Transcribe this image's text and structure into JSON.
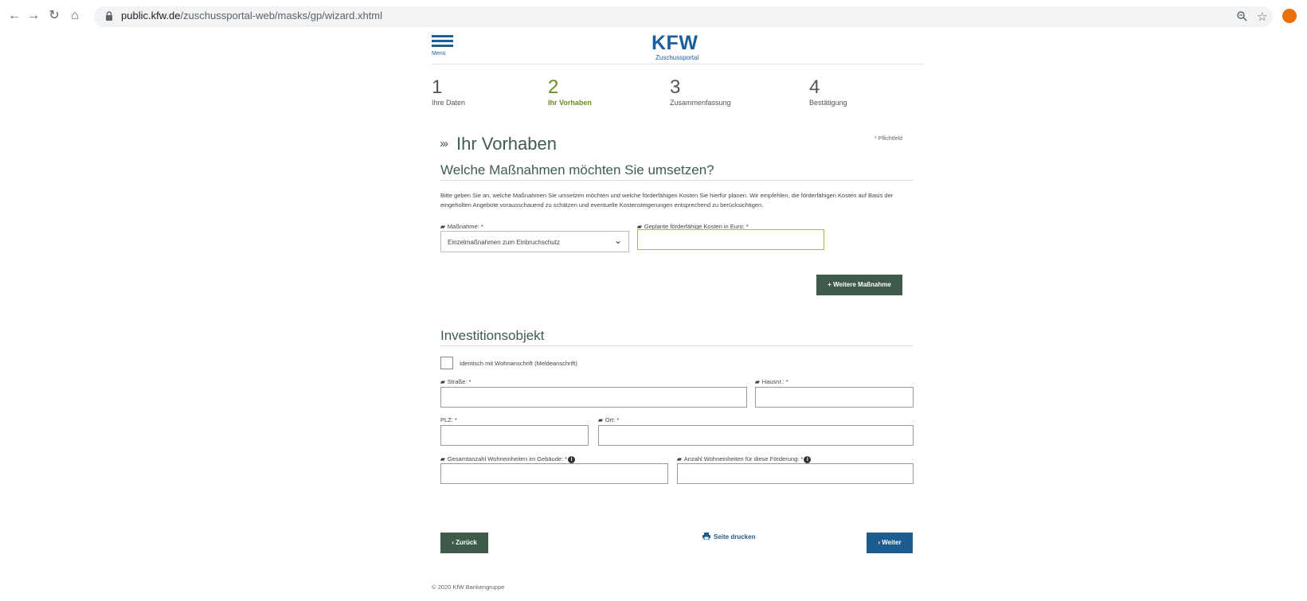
{
  "browser": {
    "url_host": "public.kfw.de",
    "url_path": "/zuschussportal-web/masks/gp/wizard.xhtml"
  },
  "header": {
    "menu_label": "Menü",
    "logo": "KFW",
    "logo_sub": "Zuschussportal"
  },
  "steps": [
    {
      "number": "1",
      "label": "Ihre Daten"
    },
    {
      "number": "2",
      "label": "Ihr Vorhaben"
    },
    {
      "number": "3",
      "label": "Zusammenfassung"
    },
    {
      "number": "4",
      "label": "Bestätigung"
    }
  ],
  "page": {
    "chevrons": "›››",
    "title": "Ihr Vorhaben",
    "required_note": "* Pflichtfeld"
  },
  "measures": {
    "heading": "Welche Maßnahmen möchten Sie umsetzen?",
    "description": "Bitte geben Sie an, welche Maßnahmen Sie umsetzen möchten und welche förderfähigen Kosten Sie hierfür planen. Wir empfehlen, die förderfähigen Kosten auf Basis der eingeholten Angebote vorausschauend zu schätzen und eventuelle Kostensteigerungen entsprechend zu berücksichtigen.",
    "measure_label": "Maßnahme: *",
    "measure_value": "Einzelmaßnahmen zum Einbruchschutz",
    "cost_label": "Geplante förderfähige Kosten in Euro: *",
    "cost_value": "",
    "add_button": "+ Weitere Maßnahme"
  },
  "investment": {
    "heading": "Investitionsobjekt",
    "same_address_label": "Identisch mit Wohnanschrift (Meldeanschrift)",
    "street_label": "Straße: *",
    "house_label": "Hausnr.: *",
    "plz_label": "PLZ: *",
    "city_label": "Ort: *",
    "total_units_label": "Gesamtanzahl Wohneinheiten im Gebäude: *",
    "funded_units_label": "Anzahl Wohneinheiten für diese Förderung: *"
  },
  "actions": {
    "back": "‹ Zurück",
    "print": "Seite drucken",
    "next": "› Weiter"
  },
  "footer": "© 2020 KfW Bankengruppe",
  "colors": {
    "kfw_blue": "#1b5e9c",
    "active_step": "#6b8c21",
    "button_green": "#3e5a4b",
    "button_blue": "#1d5c8f"
  }
}
